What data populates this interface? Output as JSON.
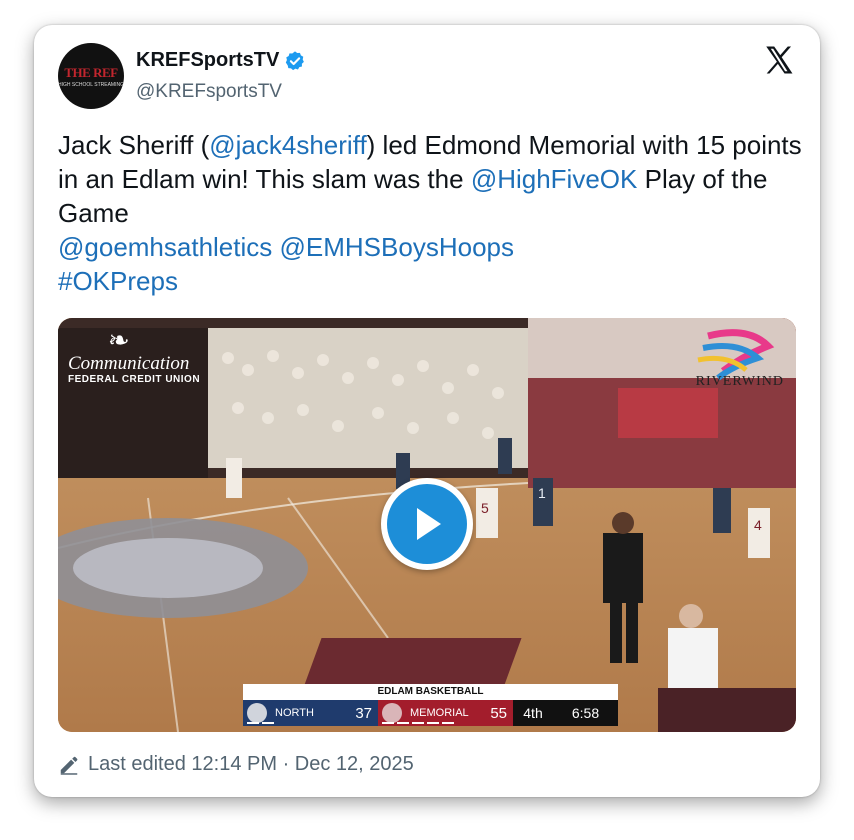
{
  "author": {
    "display_name": "KREFSportsTV",
    "handle": "@KREFsportsTV",
    "avatar_text": "THE REF",
    "avatar_subtext": "HIGH SCHOOL STREAMING"
  },
  "tweet": {
    "t1": "Jack Sheriff (",
    "m1": "@jack4sheriff",
    "t2": ") led Edmond Memorial with 15 points in an Edlam win! This slam was the ",
    "m2": "@HighFiveOK",
    "t3": " Play of the Game",
    "m3": "@goemhsathletics",
    "m4": "@EMHSBoysHoops",
    "h1": "#OKPreps"
  },
  "video": {
    "sponsor_left_name": "Communication",
    "sponsor_left_sub": "FEDERAL CREDIT UNION",
    "sponsor_right": "RIVERWIND",
    "scorebug": {
      "title": "EDLAM BASKETBALL",
      "home_team": "NORTH",
      "home_score": "37",
      "away_team": "MEMORIAL",
      "away_score": "55",
      "period": "4th",
      "clock": "6:58"
    },
    "jersey_a": "5",
    "jersey_b": "1",
    "jersey_c": "4"
  },
  "footer": {
    "edited_text": "Last edited 12:14 PM · Dec 12, 2025"
  },
  "colors": {
    "link": "#1d6fb8",
    "play": "#1d8ed8",
    "north": "#1f3b6d",
    "memorial": "#a31d2c"
  }
}
